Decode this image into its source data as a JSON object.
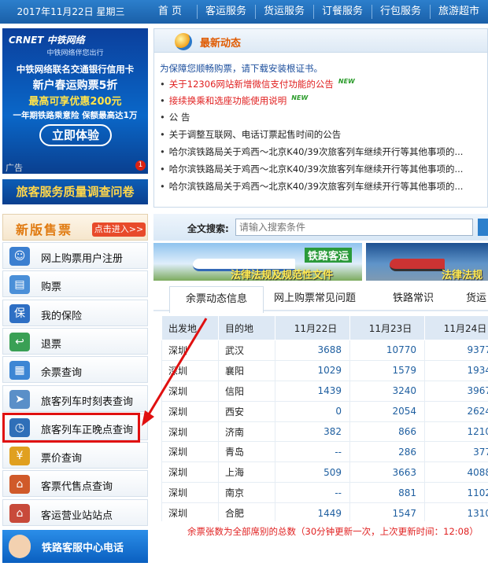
{
  "topbar": {
    "date": "2017年11月22日 星期三",
    "nav": [
      "首 页",
      "客运服务",
      "货运服务",
      "订餐服务",
      "行包服务",
      "旅游超市"
    ]
  },
  "ad": {
    "logo": "CRNET 中铁网络",
    "tagline": "中铁网络伴您出行",
    "line1": "中铁网络联名交通银行信用卡",
    "line2": "新户春运购票5折",
    "line3": "最高可享优惠200元",
    "line4": "一年期铁路乘意险 保额最高达1万",
    "button": "立即体验",
    "tag": "广告",
    "badge": "1"
  },
  "survey": "旅客服务质量调查问卷",
  "news": {
    "title": "最新动态",
    "items": [
      {
        "text": "为保障您顺畅购票，请下载安装根证书。",
        "color": "#1a4d9c",
        "bullet": "",
        "new": false
      },
      {
        "text": "关于12306网站新增微信支付功能的公告",
        "color": "#e02020",
        "bullet": "•",
        "new": true
      },
      {
        "text": "接续换乘和选座功能使用说明",
        "color": "#e02020",
        "bullet": "•",
        "new": true
      },
      {
        "text": "公 告",
        "color": "#222",
        "bullet": "•",
        "new": false
      },
      {
        "text": "关于调整互联网、电话订票起售时间的公告",
        "color": "#222",
        "bullet": "•",
        "new": false
      },
      {
        "text": "哈尔滨铁路局关于鸡西～北京K40/39次旅客列车继续开行等其他事项的...",
        "color": "#222",
        "bullet": "•",
        "new": false
      },
      {
        "text": "哈尔滨铁路局关于鸡西～北京K40/39次旅客列车继续开行等其他事项的...",
        "color": "#222",
        "bullet": "•",
        "new": false
      },
      {
        "text": "哈尔滨铁路局关于鸡西～北京K40/39次旅客列车继续开行等其他事项的...",
        "color": "#222",
        "bullet": "•",
        "new": false
      }
    ],
    "new_label": "NEW"
  },
  "new_ticket": {
    "label": "新版售票",
    "button": "点击进入>>"
  },
  "menu": [
    {
      "label": "网上购票用户注册",
      "icon": "user-register-icon",
      "color": "#3b7fd0",
      "glyph": "☺"
    },
    {
      "label": "购票",
      "icon": "ticket-icon",
      "color": "#4a8fd8",
      "glyph": "▤"
    },
    {
      "label": "我的保险",
      "icon": "insurance-shield-icon",
      "color": "#2e6fc4",
      "glyph": "保"
    },
    {
      "label": "退票",
      "icon": "refund-arrow-icon",
      "color": "#3aa055",
      "glyph": "↩"
    },
    {
      "label": "余票查询",
      "icon": "remaining-ticket-icon",
      "color": "#3d86d4",
      "glyph": "▦"
    },
    {
      "label": "旅客列车时刻表查询",
      "icon": "train-schedule-icon",
      "color": "#5a8fc8",
      "glyph": "➤"
    },
    {
      "label": "旅客列车正晚点查询",
      "icon": "clock-icon",
      "color": "#2f6fb8",
      "glyph": "◷"
    },
    {
      "label": "票价查询",
      "icon": "price-yen-icon",
      "color": "#e0a020",
      "glyph": "¥"
    },
    {
      "label": "客票代售点查询",
      "icon": "ticket-agency-icon",
      "color": "#d05a2a",
      "glyph": "⌂"
    },
    {
      "label": "客运营业站站点",
      "icon": "station-house-icon",
      "color": "#c84a3a",
      "glyph": "⌂"
    }
  ],
  "hotline": "铁路客服中心电话",
  "search": {
    "label": "全文搜索:",
    "placeholder": "请输入搜索条件"
  },
  "banners": [
    {
      "t1": "铁路客运",
      "t2": "法律法规及规范性文件"
    },
    {
      "t1": "",
      "t2": "法律法规"
    }
  ],
  "tabs": [
    "余票动态信息",
    "网上购票常见问题",
    "铁路常识",
    "货运"
  ],
  "table": {
    "headers": [
      "出发地",
      "目的地",
      "11月22日",
      "11月23日",
      "11月24日"
    ],
    "rows": [
      [
        "深圳",
        "武汉",
        "3688",
        "10770",
        "9377"
      ],
      [
        "深圳",
        "襄阳",
        "1029",
        "1579",
        "1934"
      ],
      [
        "深圳",
        "信阳",
        "1439",
        "3240",
        "3967"
      ],
      [
        "深圳",
        "西安",
        "0",
        "2054",
        "2624"
      ],
      [
        "深圳",
        "济南",
        "382",
        "866",
        "1210"
      ],
      [
        "深圳",
        "青岛",
        "--",
        "286",
        "377"
      ],
      [
        "深圳",
        "上海",
        "509",
        "3663",
        "4088"
      ],
      [
        "深圳",
        "南京",
        "--",
        "881",
        "1102"
      ],
      [
        "深圳",
        "合肥",
        "1449",
        "1547",
        "1310"
      ]
    ]
  },
  "note": "余票张数为全部席别的总数（30分钟更新一次，上次更新时间：12:08）"
}
